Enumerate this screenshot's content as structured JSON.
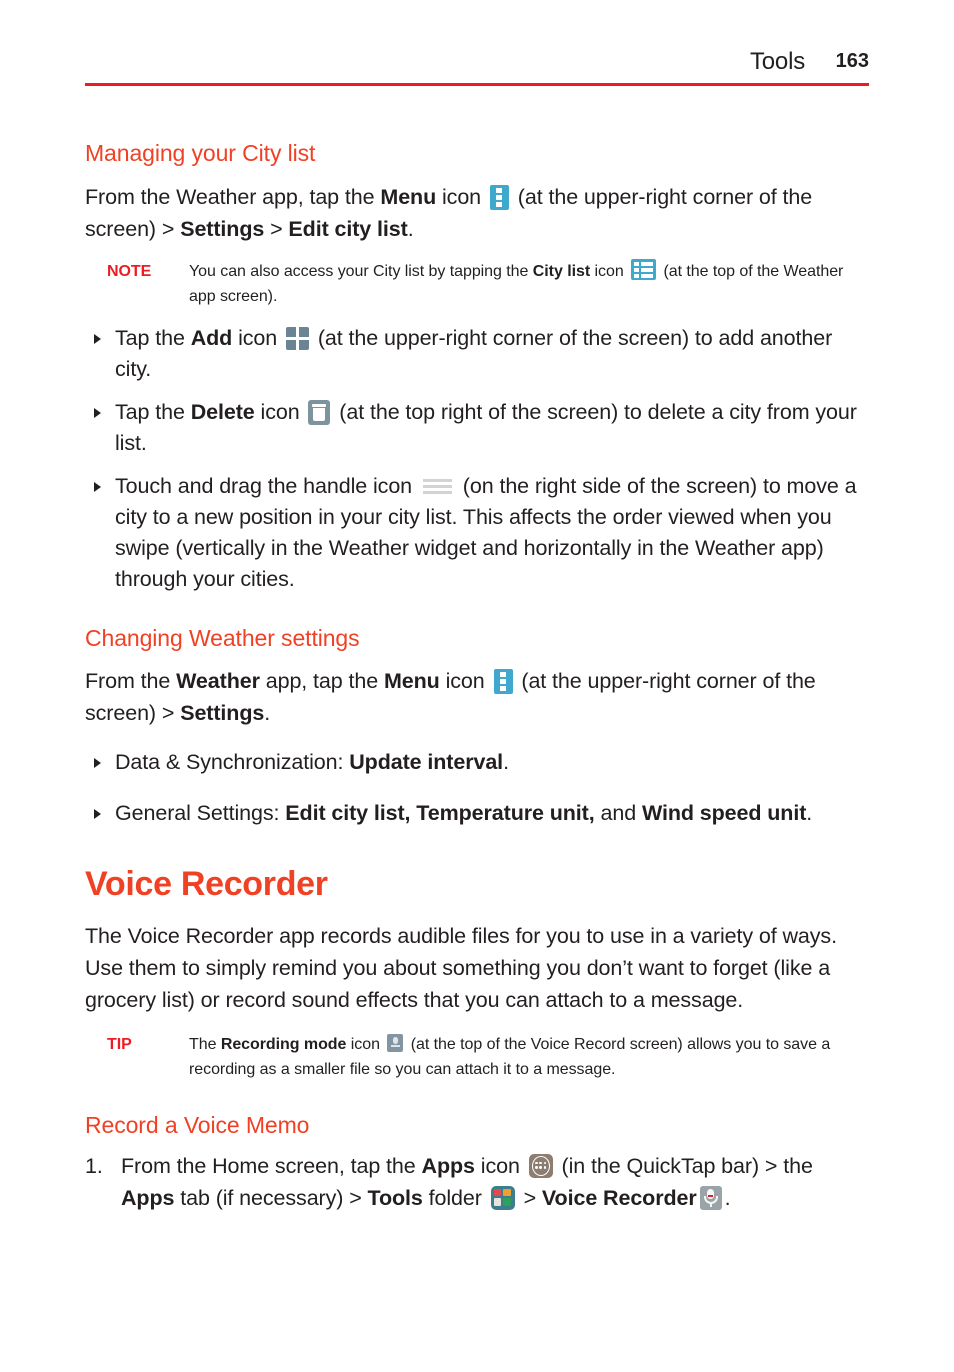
{
  "header": {
    "title": "Tools",
    "page_number": "163",
    "rule_color": "#ed1c24"
  },
  "sections": {
    "managing_city_list": {
      "heading": "Managing your City list",
      "intro": {
        "part1": "From the Weather app, tap the ",
        "menu_label": "Menu",
        "part2": " icon ",
        "part3": " (at the upper-right corner of the screen) > ",
        "settings_label": "Settings",
        "part4": " > ",
        "edit_city_list_label": "Edit city list",
        "part5": "."
      },
      "note": {
        "tag": "NOTE",
        "part1": "You can also access your City list by tapping the ",
        "city_list_label": "City list",
        "part2": " icon ",
        "part3": " (at the top of the Weather app screen)."
      },
      "bullets": [
        {
          "part1": "Tap the ",
          "bold1": "Add",
          "part2": " icon ",
          "icon": "add-icon",
          "part3": " (at the upper-right corner of the screen) to add another city."
        },
        {
          "part1": "Tap the ",
          "bold1": "Delete",
          "part2": " icon ",
          "icon": "delete-icon",
          "part3": " (at the top right of the screen) to delete a city from your list."
        },
        {
          "part1": "Touch and drag the handle icon ",
          "bold1": "",
          "part2": "",
          "icon": "handle-icon",
          "part3": " (on the right side of the screen) to move a city to a new position in your city list. This affects the order viewed when you swipe (vertically in the Weather widget and horizontally in the Weather app) through your cities."
        }
      ]
    },
    "changing_weather_settings": {
      "heading": "Changing Weather settings",
      "intro": {
        "part1": "From the ",
        "weather_label": "Weather",
        "part2": " app, tap the ",
        "menu_label": "Menu",
        "part3": " icon ",
        "part4": " (at the upper-right corner of the screen) > ",
        "settings_label": "Settings",
        "part5": "."
      },
      "bullets": [
        {
          "part1": "Data & Synchronization: ",
          "bold1": "Update interval",
          "part2": "."
        },
        {
          "part1": "General Settings: ",
          "bold1": "Edit city list, Temperature unit,",
          "part2": " and ",
          "bold2": "Wind speed unit",
          "part3": "."
        }
      ]
    },
    "voice_recorder": {
      "heading": "Voice Recorder",
      "body": "The Voice Recorder app records audible files for you to use in a variety of ways. Use them to simply remind you about something you don’t want to forget (like a grocery list) or record sound effects that you can attach to a message.",
      "tip": {
        "tag": "TIP",
        "part1": "The ",
        "recording_mode_label": "Recording mode",
        "part2": " icon ",
        "part3": " (at the top of the Voice Record screen) allows you to save a recording as a smaller file so you can attach it to a message."
      }
    },
    "record_voice_memo": {
      "heading": "Record a Voice Memo",
      "steps": [
        {
          "num": "1.",
          "part1": "From the Home screen, tap the ",
          "bold1": "Apps",
          "part2": " icon ",
          "part3": " (in the QuickTap bar) > the ",
          "bold2": "Apps",
          "part4": " tab (if necessary) > ",
          "bold3": "Tools",
          "part5": " folder ",
          "part6": " > ",
          "bold4": "Voice Recorder",
          "part7": "."
        }
      ]
    }
  },
  "icons": {
    "menu": "menu-icon",
    "city_list": "city-list-icon",
    "add": "add-icon",
    "delete": "delete-icon",
    "handle": "handle-icon",
    "recording_mode": "recording-mode-icon",
    "apps": "apps-icon",
    "tools_folder": "tools-folder-icon",
    "voice_recorder": "voice-recorder-icon"
  },
  "colors": {
    "heading_red": "#f04124",
    "rule_red": "#ed1c24",
    "icon_teal": "#3fa9cd",
    "icon_slate": "#6b8494",
    "body_text": "#231f20"
  }
}
